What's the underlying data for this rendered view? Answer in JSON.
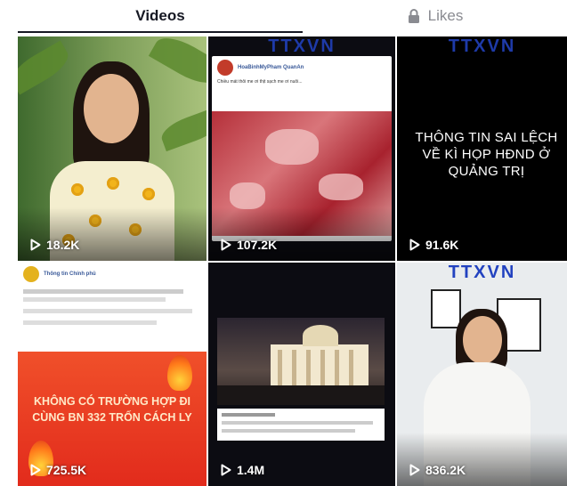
{
  "tabs": {
    "videos_label": "Videos",
    "likes_label": "Likes"
  },
  "icons": {
    "lock": "lock-icon",
    "play": "play-icon"
  },
  "colors": {
    "active_tab": "#161823",
    "inactive_tab": "#8a8b91",
    "overlay_text": "#ffffff"
  },
  "videos": [
    {
      "views": "18.2K"
    },
    {
      "views": "107.2K",
      "brand": "TTXVN",
      "post_author": "HoaBinhMyPham QuanAn",
      "post_text": "Chiều mát thôi me ơi thịt sạch me ơi nuôi..."
    },
    {
      "views": "91.6K",
      "brand": "TTXVN",
      "caption": "THÔNG TIN SAI LỆCH VỀ KÌ HỌP HĐND Ở QUẢNG TRỊ"
    },
    {
      "views": "725.5K",
      "post_author": "Thông tin Chính phủ",
      "banner_text": "KHÔNG CÓ TRƯỜNG HỢP ĐI CÙNG BN 332 TRỐN CÁCH LY"
    },
    {
      "views": "1.4M"
    },
    {
      "views": "836.2K",
      "brand": "TTXVN"
    }
  ]
}
